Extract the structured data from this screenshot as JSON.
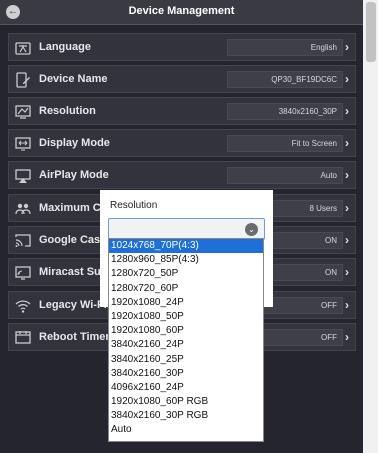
{
  "header": {
    "title": "Device Management",
    "back_icon": "back-arrow-icon"
  },
  "rows": [
    {
      "icon": "language-icon",
      "label": "Language",
      "value": "English"
    },
    {
      "icon": "device-name-icon",
      "label": "Device Name",
      "value": "QP30_BF19DC6C"
    },
    {
      "icon": "resolution-icon",
      "label": "Resolution",
      "value": "3840x2160_30P"
    },
    {
      "icon": "display-mode-icon",
      "label": "Display Mode",
      "value": "Fit to Screen"
    },
    {
      "icon": "airplay-icon",
      "label": "AirPlay Mode",
      "value": "Auto"
    },
    {
      "icon": "users-icon",
      "label": "Maximum Con",
      "value": "8 Users"
    },
    {
      "icon": "cast-icon",
      "label": "Google Cast S",
      "value": "ON"
    },
    {
      "icon": "miracast-icon",
      "label": "Miracast Supp",
      "value": "ON"
    },
    {
      "icon": "wifi-icon",
      "label": "Legacy Wi-Fi",
      "value": "OFF"
    },
    {
      "icon": "timer-icon",
      "label": "Reboot Timer",
      "value": "OFF"
    }
  ],
  "dialog": {
    "title": "Resolution",
    "options": [
      "1024x768_70P(4:3)",
      "1280x960_85P(4:3)",
      "1280x720_50P",
      "1280x720_60P",
      "1920x1080_24P",
      "1920x1080_50P",
      "1920x1080_60P",
      "3840x2160_24P",
      "3840x2160_25P",
      "3840x2160_30P",
      "4096x2160_24P",
      "1920x1080_60P RGB",
      "3840x2160_30P RGB",
      "Auto"
    ],
    "highlighted_option": "1024x768_70P(4:3)"
  },
  "colors": {
    "panel": "#25252f",
    "row": "#33333d",
    "highlight": "#1e6fd9"
  }
}
